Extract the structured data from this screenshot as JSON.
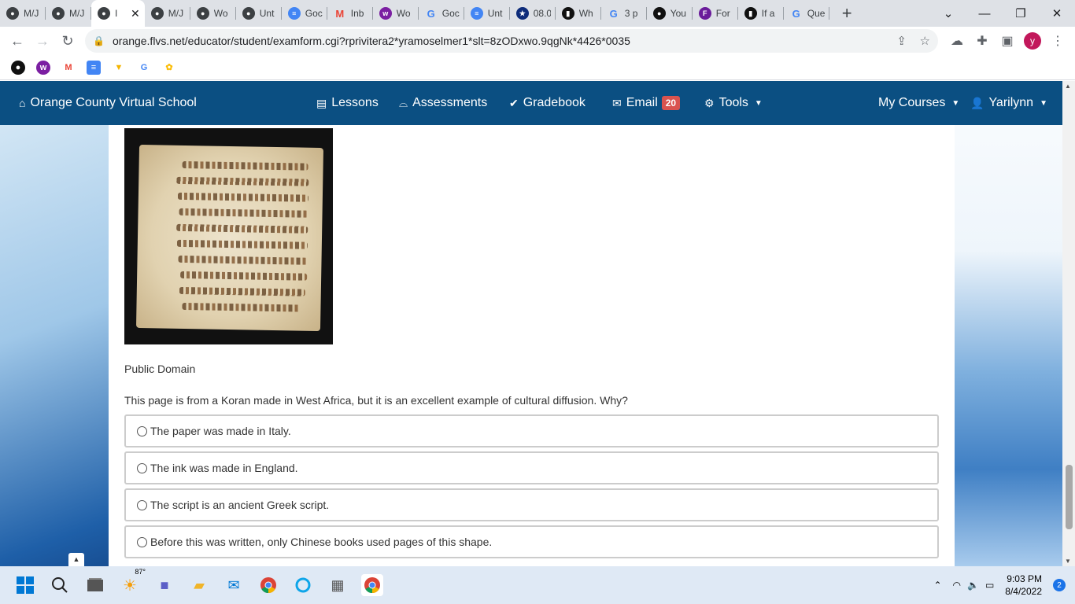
{
  "browser": {
    "tabs": [
      {
        "title": "M/J",
        "favicon": "globe-icon",
        "color": "#3c4043"
      },
      {
        "title": "M/J",
        "favicon": "globe-icon",
        "color": "#3c4043"
      },
      {
        "title": "I",
        "favicon": "globe-icon",
        "color": "#3c4043",
        "active": true
      },
      {
        "title": "M/J",
        "favicon": "globe-icon",
        "color": "#3c4043"
      },
      {
        "title": "Wo",
        "favicon": "globe-icon",
        "color": "#3c4043"
      },
      {
        "title": "Unt",
        "favicon": "globe-icon",
        "color": "#3c4043"
      },
      {
        "title": "Goc",
        "favicon": "docs-icon",
        "color": "#4285f4"
      },
      {
        "title": "Inb",
        "favicon": "gmail-icon",
        "color": "#ea4335"
      },
      {
        "title": "Wo",
        "favicon": "w-icon",
        "color": "#7b1fa2"
      },
      {
        "title": "Goc",
        "favicon": "google-icon",
        "color": "#4285f4"
      },
      {
        "title": "Unt",
        "favicon": "docs-icon",
        "color": "#4285f4"
      },
      {
        "title": "08.0",
        "favicon": "star-icon",
        "color": "#0d2b7a"
      },
      {
        "title": "Wh",
        "favicon": "book-icon",
        "color": "#111111"
      },
      {
        "title": "3 p",
        "favicon": "google-icon",
        "color": "#4285f4"
      },
      {
        "title": "You",
        "favicon": "bulb-icon",
        "color": "#111111"
      },
      {
        "title": "For",
        "favicon": "f-icon",
        "color": "#6a1b9a"
      },
      {
        "title": "If a",
        "favicon": "book-icon",
        "color": "#111111"
      },
      {
        "title": "Que",
        "favicon": "google-icon",
        "color": "#4285f4"
      }
    ],
    "url": "orange.flvs.net/educator/student/examform.cgi?rprivitera2*yramoselmer1*slt=8zODxwo.9qgNk*4426*0035",
    "profile_initial": "y"
  },
  "nav": {
    "brand": "Orange County Virtual School",
    "lessons": "Lessons",
    "assessments": "Assessments",
    "gradebook": "Gradebook",
    "email": "Email",
    "email_count": "20",
    "tools": "Tools",
    "my_courses": "My Courses",
    "user": "Yarilynn"
  },
  "content": {
    "image_credit": "Public Domain",
    "question": "This page is from a Koran made in West Africa, but it is an excellent example of cultural diffusion. Why?",
    "options": [
      "The paper was made in Italy.",
      "The ink was made in England.",
      "The script is an ancient Greek script.",
      "Before this was written, only Chinese books used pages of this shape."
    ]
  },
  "taskbar": {
    "weather": "87°",
    "time": "9:03 PM",
    "date": "8/4/2022",
    "notifications": "2"
  }
}
